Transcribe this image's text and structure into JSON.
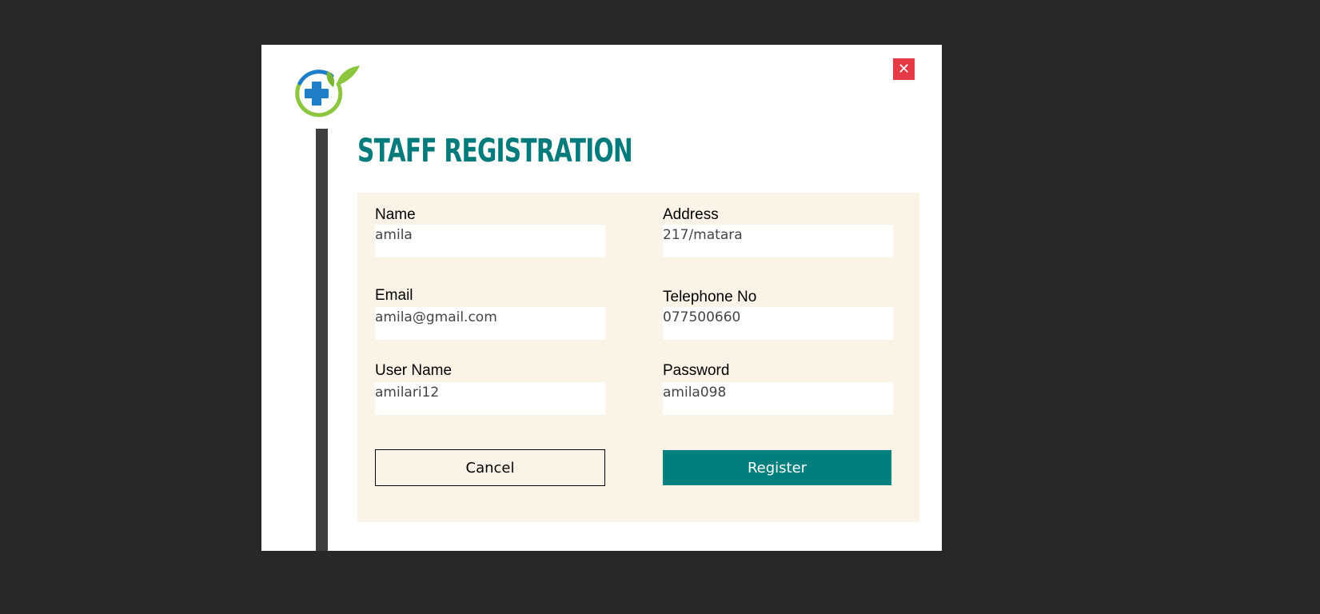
{
  "window": {
    "title": "STAFF REGISTRATION",
    "close_label": "✕"
  },
  "form": {
    "name": {
      "label": "Name",
      "value": "amila"
    },
    "address": {
      "label": "Address",
      "value": "217/matara"
    },
    "email": {
      "label": "Email",
      "value": "amila@gmail.com"
    },
    "telephone": {
      "label": "Telephone No",
      "value": "077500660"
    },
    "username": {
      "label": "User Name",
      "value": "amilari12"
    },
    "password": {
      "label": "Password",
      "value": "amila098"
    }
  },
  "actions": {
    "cancel_label": "Cancel",
    "register_label": "Register"
  },
  "colors": {
    "accent": "#007f7f",
    "close": "#e63946",
    "panel": "#fbf4e6",
    "backdrop": "#282828"
  },
  "icons": {
    "logo": "medical-cross-leaf-logo",
    "close": "close-icon"
  }
}
